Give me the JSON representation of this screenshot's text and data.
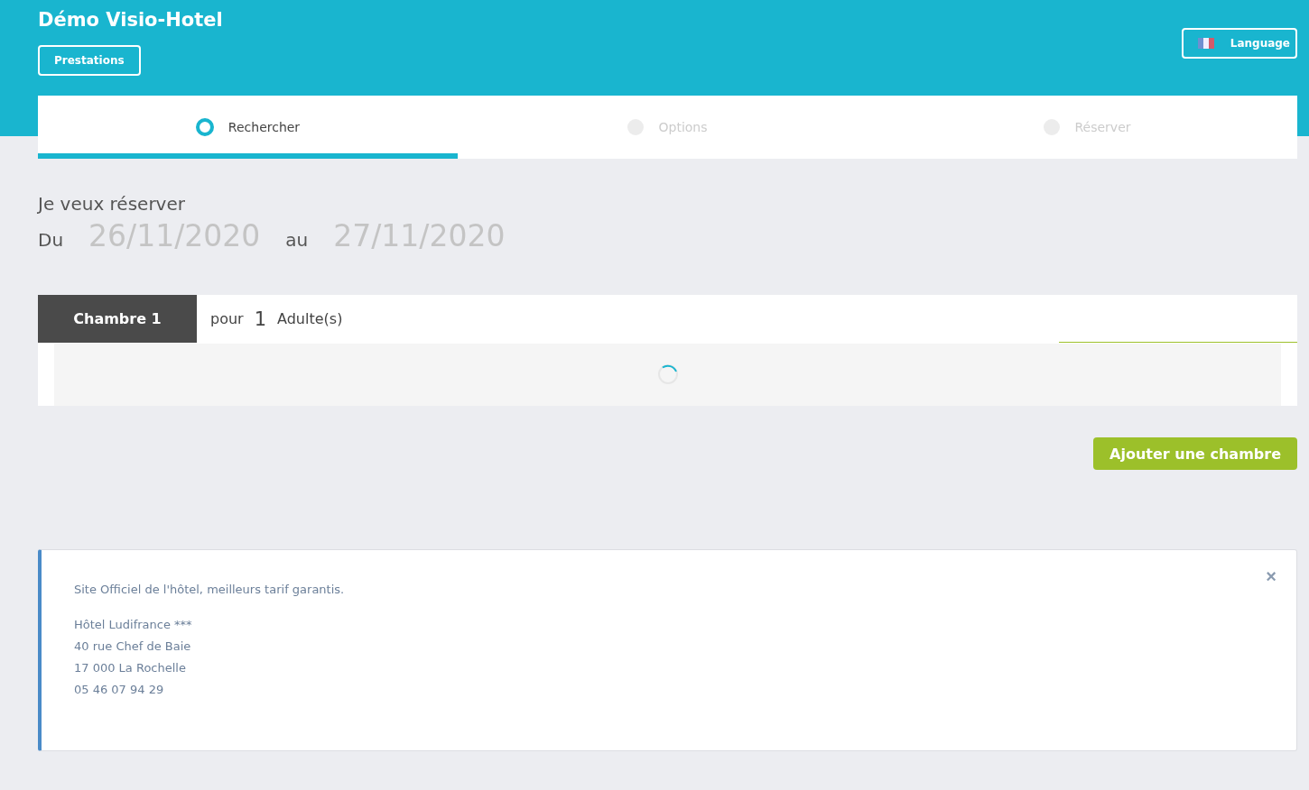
{
  "header": {
    "title": "Démo Visio-Hotel",
    "services_button": "Prestations",
    "language_button": "Language"
  },
  "steps": [
    {
      "label": "Rechercher",
      "selected": true
    },
    {
      "label": "Options",
      "selected": false
    },
    {
      "label": "Réserver",
      "selected": false
    }
  ],
  "search": {
    "heading": "Je veux réserver",
    "from_label": "Du",
    "from_date": "26/11/2020",
    "to_label": "au",
    "to_date": "27/11/2020"
  },
  "rooms": [
    {
      "tab": "Chambre 1",
      "for_label": "pour",
      "adults": "1",
      "adults_label": "Adulte(s)",
      "loading": true
    }
  ],
  "add_room_button": "Ajouter une chambre",
  "info": {
    "close": "×",
    "intro": "Site Officiel de l'hôtel, meilleurs tarif garantis.",
    "address": [
      "Hôtel Ludifrance ***",
      "40 rue Chef de Baie",
      "17 000 La Rochelle",
      "05 46 07 94 29"
    ]
  }
}
